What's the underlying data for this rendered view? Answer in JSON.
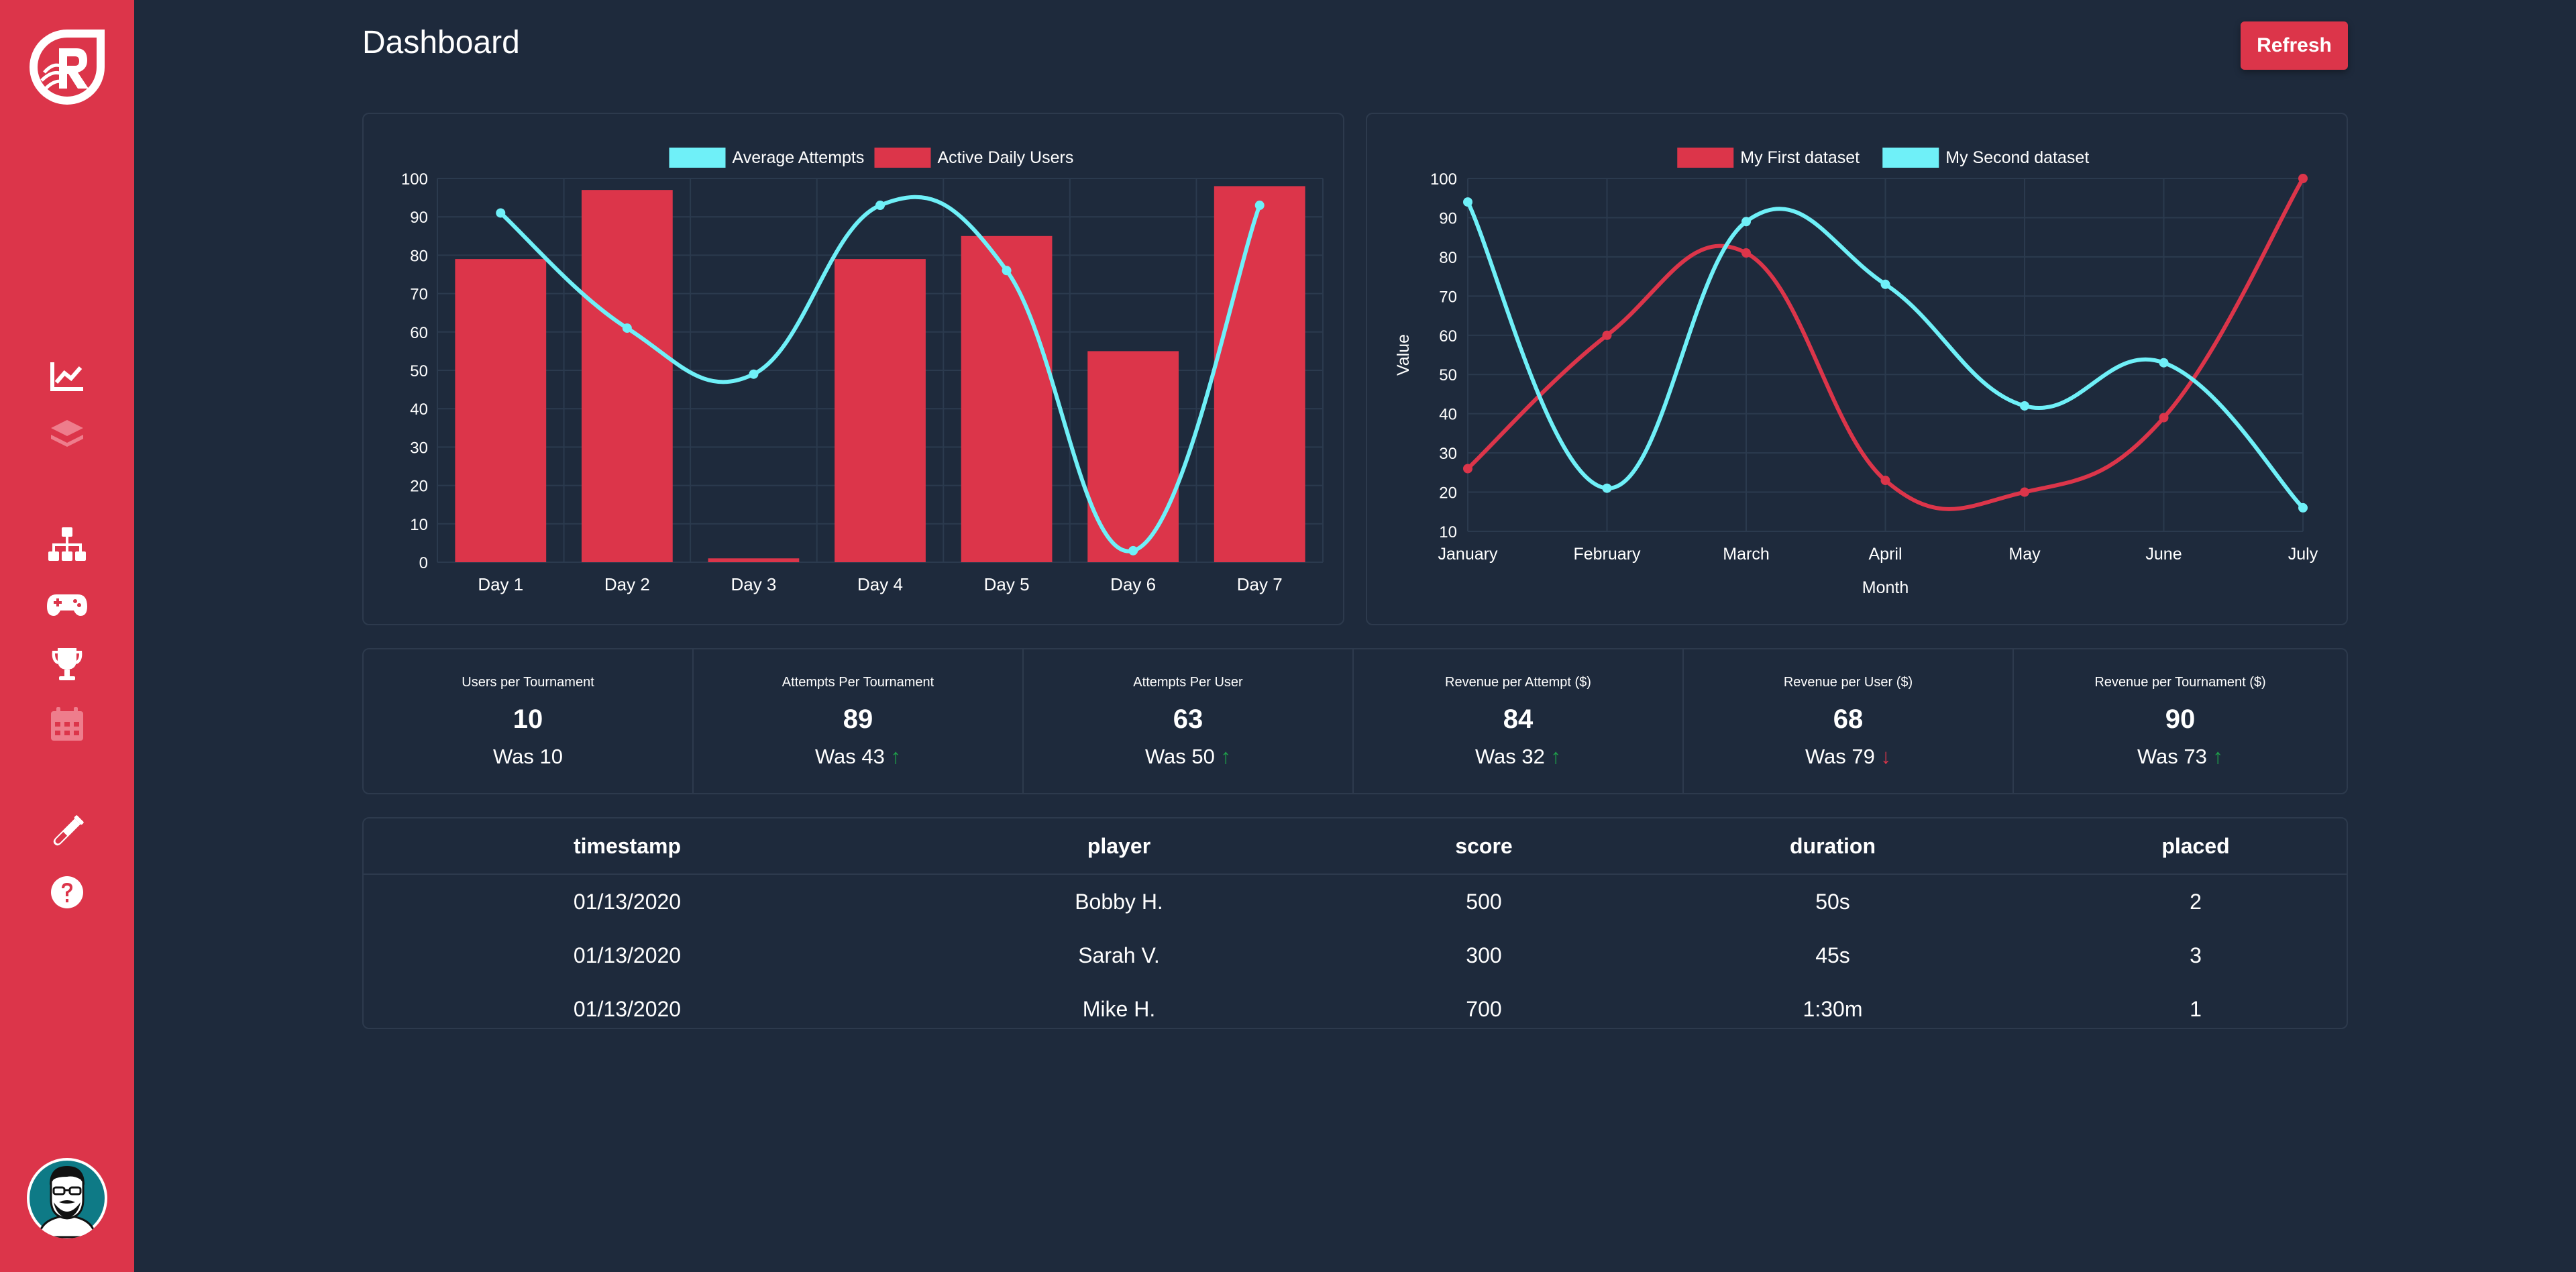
{
  "header": {
    "title": "Dashboard",
    "refresh_label": "Refresh"
  },
  "sidebar": {
    "items": [
      {
        "icon": "line-chart-icon",
        "active": true
      },
      {
        "icon": "layers-icon",
        "active": false
      },
      {
        "icon": "sitemap-icon",
        "active": true
      },
      {
        "icon": "gamepad-icon",
        "active": true
      },
      {
        "icon": "trophy-icon",
        "active": true
      },
      {
        "icon": "calendar-icon",
        "active": false
      },
      {
        "icon": "flask-icon",
        "active": true
      },
      {
        "icon": "help-icon",
        "active": true
      }
    ]
  },
  "colors": {
    "accent": "#dc354a",
    "cyan": "#6ff0f8",
    "background": "#1e2a3c",
    "up": "#1fa04a",
    "down": "#dc354a"
  },
  "chart_data": [
    {
      "type": "bar",
      "categories": [
        "Day 1",
        "Day 2",
        "Day 3",
        "Day 4",
        "Day 5",
        "Day 6",
        "Day 7"
      ],
      "ylim": [
        0,
        100
      ],
      "yticks": [
        0,
        10,
        20,
        30,
        40,
        50,
        60,
        70,
        80,
        90,
        100
      ],
      "legend": [
        "Average Attempts",
        "Active Daily Users"
      ],
      "series": [
        {
          "name": "Active Daily Users",
          "type": "bar",
          "color": "#dc354a",
          "values": [
            79,
            97,
            1,
            79,
            85,
            55,
            98
          ]
        },
        {
          "name": "Average Attempts",
          "type": "line",
          "color": "#6ff0f8",
          "values": [
            91,
            61,
            49,
            93,
            76,
            3,
            93
          ]
        }
      ],
      "legend_position": "top-center",
      "grid": true
    },
    {
      "type": "line",
      "categories": [
        "January",
        "February",
        "March",
        "April",
        "May",
        "June",
        "July"
      ],
      "ylim": [
        10,
        100
      ],
      "yticks": [
        10,
        20,
        30,
        40,
        50,
        60,
        70,
        80,
        90,
        100
      ],
      "xlabel": "Month",
      "ylabel": "Value",
      "legend": [
        "My First dataset",
        "My Second dataset"
      ],
      "series": [
        {
          "name": "My First dataset",
          "color": "#dc354a",
          "values": [
            26,
            60,
            81,
            23,
            20,
            39,
            100
          ]
        },
        {
          "name": "My Second dataset",
          "color": "#6ff0f8",
          "values": [
            94,
            21,
            89,
            73,
            42,
            53,
            16
          ]
        }
      ],
      "legend_position": "top-center",
      "grid": true
    }
  ],
  "stats": [
    {
      "label": "Users per Tournament",
      "value": "10",
      "was": "Was 10",
      "trend": ""
    },
    {
      "label": "Attempts Per Tournament",
      "value": "89",
      "was": "Was 43",
      "trend": "↑"
    },
    {
      "label": "Attempts Per User",
      "value": "63",
      "was": "Was 50",
      "trend": "↑"
    },
    {
      "label": "Revenue per Attempt ($)",
      "value": "84",
      "was": "Was 32",
      "trend": "↑"
    },
    {
      "label": "Revenue per User ($)",
      "value": "68",
      "was": "Was 79",
      "trend": "↓"
    },
    {
      "label": "Revenue per Tournament ($)",
      "value": "90",
      "was": "Was 73",
      "trend": "↑"
    }
  ],
  "table": {
    "columns": [
      "timestamp",
      "player",
      "score",
      "duration",
      "placed"
    ],
    "rows": [
      [
        "01/13/2020",
        "Bobby H.",
        "500",
        "50s",
        "2"
      ],
      [
        "01/13/2020",
        "Sarah V.",
        "300",
        "45s",
        "3"
      ],
      [
        "01/13/2020",
        "Mike H.",
        "700",
        "1:30m",
        "1"
      ]
    ]
  }
}
